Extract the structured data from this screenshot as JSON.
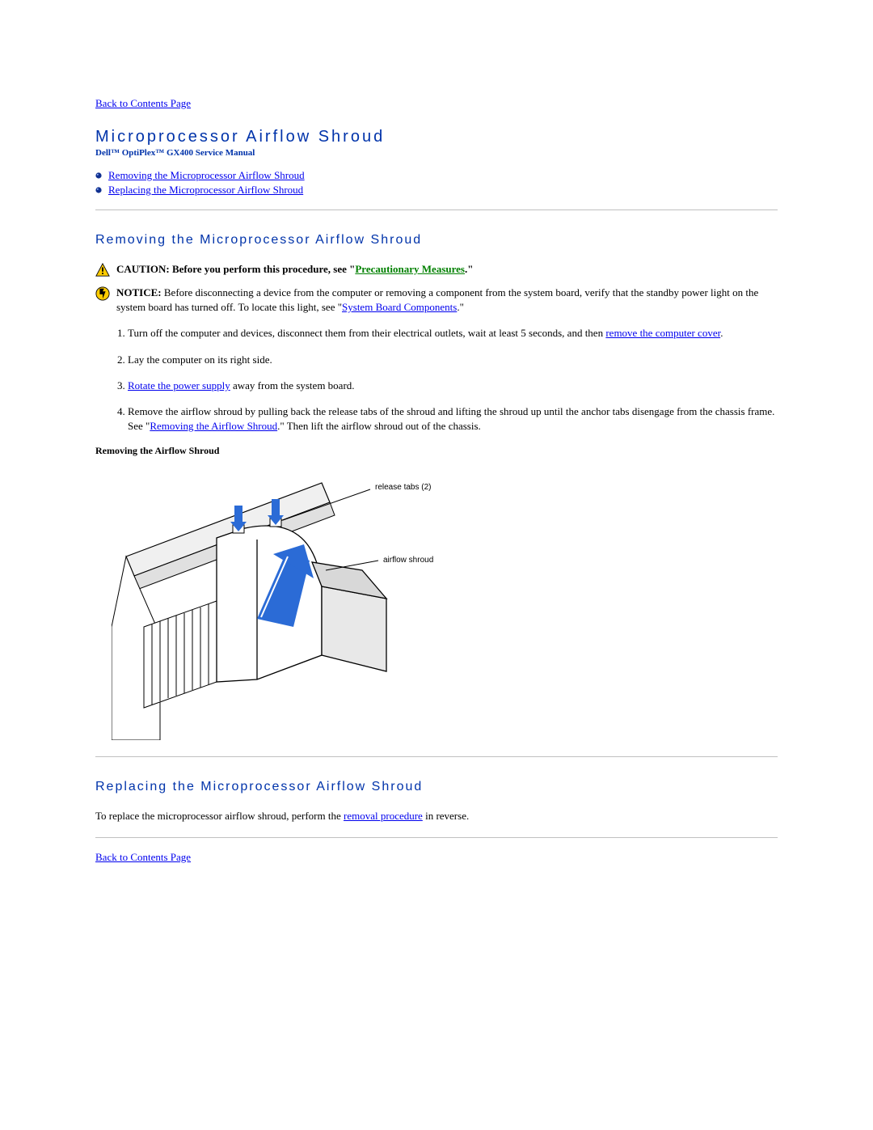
{
  "nav": {
    "back_top": "Back to Contents Page",
    "back_bottom": "Back to Contents Page"
  },
  "title": "Microprocessor Airflow Shroud",
  "subtitle": "Dell™ OptiPlex™ GX400 Service Manual",
  "toc": {
    "items": [
      {
        "label": "Removing the Microprocessor Airflow Shroud"
      },
      {
        "label": "Replacing the Microprocessor Airflow Shroud"
      }
    ]
  },
  "section_remove": {
    "heading": "Removing the Microprocessor Airflow Shroud",
    "caution": {
      "prefix": "CAUTION: Before you perform this procedure, see \"",
      "link": "Precautionary Measures",
      "suffix": ".\""
    },
    "notice": {
      "label": "NOTICE:",
      "text_a": " Before disconnecting a device from the computer or removing a component from the system board, verify that the standby power light on the system board has turned off. To locate this light, see \"",
      "link": "System Board Components",
      "text_b": ".\""
    },
    "steps": {
      "s1_a": "Turn off the computer and devices, disconnect them from their electrical outlets, wait at least 5 seconds, and then ",
      "s1_link": "remove the computer cover",
      "s1_b": ".",
      "s2": "Lay the computer on its right side.",
      "s3_link": "Rotate the power supply",
      "s3_b": " away from the system board.",
      "s4_a": "Remove the airflow shroud by pulling back the release tabs of the shroud and lifting the shroud up until the anchor tabs disengage from the chassis frame. See \"",
      "s4_link": "Removing the Airflow Shroud",
      "s4_b": ".\" Then lift the airflow shroud out of the chassis."
    },
    "figure_caption": "Removing the Airflow Shroud",
    "figure_labels": {
      "release_tabs": "release tabs (2)",
      "airflow_shroud": "airflow shroud"
    }
  },
  "section_replace": {
    "heading": "Replacing the Microprocessor Airflow Shroud",
    "text_a": "To replace the microprocessor airflow shroud, perform the ",
    "link": "removal procedure",
    "text_b": " in reverse."
  }
}
